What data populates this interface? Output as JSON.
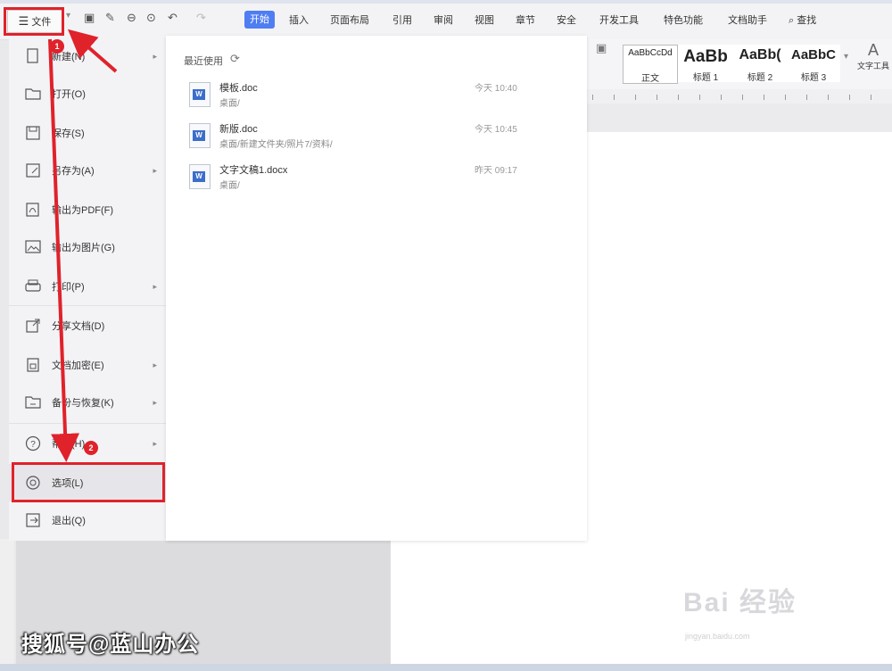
{
  "file_menu": {
    "label": "文件",
    "hamburger_icon": "hamburger-icon"
  },
  "quick_access": [
    {
      "name": "save-icon",
      "glyph": "🖫"
    },
    {
      "name": "format-painter-icon",
      "glyph": "✎"
    },
    {
      "name": "print-icon",
      "glyph": "⎙"
    },
    {
      "name": "print-preview-icon",
      "glyph": "⌕"
    },
    {
      "name": "undo-icon",
      "glyph": "↶"
    },
    {
      "name": "redo-icon",
      "glyph": "↷"
    }
  ],
  "tabs": [
    "开始",
    "插入",
    "页面布局",
    "引用",
    "审阅",
    "视图",
    "章节",
    "安全",
    "开发工具",
    "特色功能",
    "文档助手",
    "查找"
  ],
  "ribbon": {
    "styles": [
      {
        "sample": "AaBbCcDd",
        "name": "正文"
      },
      {
        "sample": "AaBb",
        "name": "标题 1"
      },
      {
        "sample": "AaBb(",
        "name": "标题 2"
      },
      {
        "sample": "AaBbC",
        "name": "标题 3"
      }
    ],
    "text_tools_label": "文字工具"
  },
  "sidebar": {
    "items": [
      {
        "label": "新建(N)",
        "icon": "new-document-icon",
        "has_submenu": true
      },
      {
        "label": "打开(O)",
        "icon": "open-folder-icon",
        "has_submenu": false
      },
      {
        "label": "保存(S)",
        "icon": "save-icon",
        "has_submenu": false
      },
      {
        "label": "另存为(A)",
        "icon": "save-as-icon",
        "has_submenu": true
      },
      {
        "label": "输出为PDF(F)",
        "icon": "pdf-export-icon",
        "has_submenu": false
      },
      {
        "label": "输出为图片(G)",
        "icon": "image-export-icon",
        "has_submenu": false
      },
      {
        "label": "打印(P)",
        "icon": "printer-icon",
        "has_submenu": true
      },
      {
        "label": "分享文档(D)",
        "icon": "share-icon",
        "has_submenu": false
      },
      {
        "label": "文档加密(E)",
        "icon": "encrypt-icon",
        "has_submenu": true
      },
      {
        "label": "备份与恢复(K)",
        "icon": "backup-icon",
        "has_submenu": true
      },
      {
        "label": "帮助(H)",
        "icon": "help-icon",
        "has_submenu": true
      },
      {
        "label": "选项(L)",
        "icon": "options-gear-icon",
        "has_submenu": false
      },
      {
        "label": "退出(Q)",
        "icon": "exit-icon",
        "has_submenu": false
      }
    ]
  },
  "recent": {
    "title": "最近使用",
    "files": [
      {
        "name": "模板.doc",
        "path": "桌面/",
        "time": "今天 10:40"
      },
      {
        "name": "新版.doc",
        "path": "桌面/新建文件夹/照片7/资料/",
        "time": "今天 10:45"
      },
      {
        "name": "文字文稿1.docx",
        "path": "桌面/",
        "time": "昨天 09:17"
      }
    ]
  },
  "annotations": {
    "step1": "1",
    "step2": "2"
  },
  "watermarks": {
    "baidu": "Bai 经验",
    "baidu_url": "jingyan.baidu.com",
    "sohu": "搜狐号@蓝山办公"
  },
  "colors": {
    "accent": "#4f7df2",
    "highlight": "#e0222b"
  }
}
